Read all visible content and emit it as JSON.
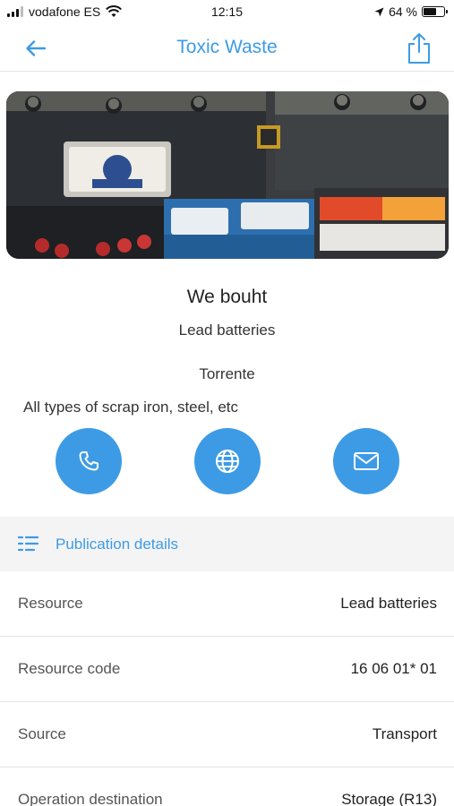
{
  "status_bar": {
    "carrier": "vodafone ES",
    "time": "12:15",
    "battery_percent": "64 %",
    "battery_level": 0.64
  },
  "nav": {
    "title": "Toxic Waste",
    "back_icon": "arrow-left-icon",
    "share_icon": "share-icon"
  },
  "listing": {
    "title": "We bouht",
    "subtitle": "Lead batteries",
    "city": "Torrente",
    "description": "All types of scrap iron, steel, etc"
  },
  "actions": [
    {
      "icon": "phone-icon"
    },
    {
      "icon": "globe-icon"
    },
    {
      "icon": "mail-icon"
    }
  ],
  "section": {
    "label": "Publication details",
    "icon": "list-icon"
  },
  "details": [
    {
      "label": "Resource",
      "value": "Lead batteries"
    },
    {
      "label": "Resource code",
      "value": "16 06 01* 01"
    },
    {
      "label": "Source",
      "value": "Transport"
    },
    {
      "label": "Operation destination",
      "value": "Storage (R13)"
    }
  ],
  "colors": {
    "accent": "#3d9be5",
    "divider": "#e4e4e4",
    "section_bg": "#f4f4f5"
  }
}
